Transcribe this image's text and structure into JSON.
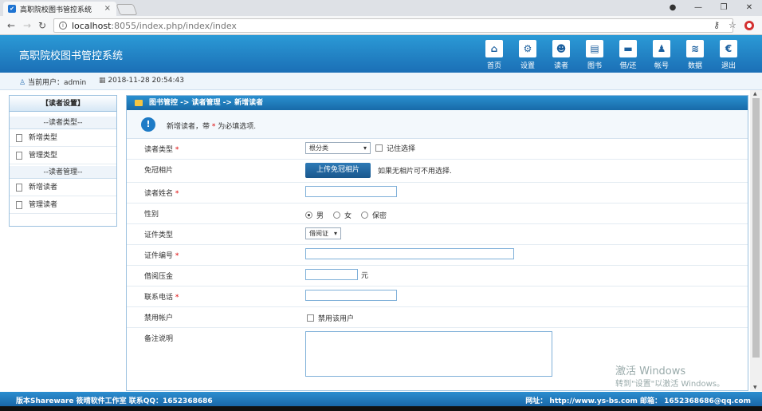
{
  "browser": {
    "tab_title": "高职院校图书管控系统",
    "url_host": "localhost",
    "url_path": ":8055/index.php/index/index"
  },
  "header": {
    "brand": "高职院校图书管控系统",
    "menu": [
      {
        "label": "首页",
        "icon": "home-icon"
      },
      {
        "label": "设置",
        "icon": "settings-icon"
      },
      {
        "label": "读者",
        "icon": "readers-icon"
      },
      {
        "label": "图书",
        "icon": "book-icon"
      },
      {
        "label": "借/还",
        "icon": "borrow-icon"
      },
      {
        "label": "帐号",
        "icon": "account-icon"
      },
      {
        "label": "数据",
        "icon": "database-icon"
      },
      {
        "label": "退出",
        "icon": "logout-icon"
      }
    ]
  },
  "infobar": {
    "user_label": "当前用户：admin",
    "time": "2018-11-28 20:54:43"
  },
  "sidebar": {
    "title": "【读者设置】",
    "sections": [
      {
        "title": "--读者类型--",
        "items": [
          "新增类型",
          "管理类型"
        ]
      },
      {
        "title": "--读者管理--",
        "items": [
          "新增读者",
          "管理读者"
        ]
      }
    ]
  },
  "main": {
    "breadcrumb": "图书管控 -> 读者管理 -> 新增读者",
    "notice_pre": "新增读者，带",
    "notice_star": "*",
    "notice_post": "为必填选项.",
    "form": {
      "reader_type_label": "读者类型",
      "reader_type_value": "根分类",
      "remember_label": "记住选择",
      "photo_label": "免冠相片",
      "upload_button": "上传免冠相片",
      "photo_hint": "如果无相片可不用选择.",
      "name_label": "读者姓名",
      "gender_label": "性别",
      "gender_options": [
        "男",
        "女",
        "保密"
      ],
      "gender_selected": "男",
      "id_type_label": "证件类型",
      "id_type_value": "借阅证",
      "id_number_label": "证件编号",
      "deposit_label": "借阅压金",
      "deposit_unit": "元",
      "phone_label": "联系电话",
      "disable_label": "禁用帐户",
      "disable_option": "禁用该用户",
      "remark_label": "备注说明"
    }
  },
  "footer": {
    "left": "版本Shareware  筱晴软件工作室  联系QQ：1652368686",
    "right": "网址：  http://www.ys-bs.com  邮箱：  1652368686@qq.com"
  },
  "watermark": {
    "line1": "激活 Windows",
    "line2": "转到\"设置\"以激活 Windows。"
  }
}
